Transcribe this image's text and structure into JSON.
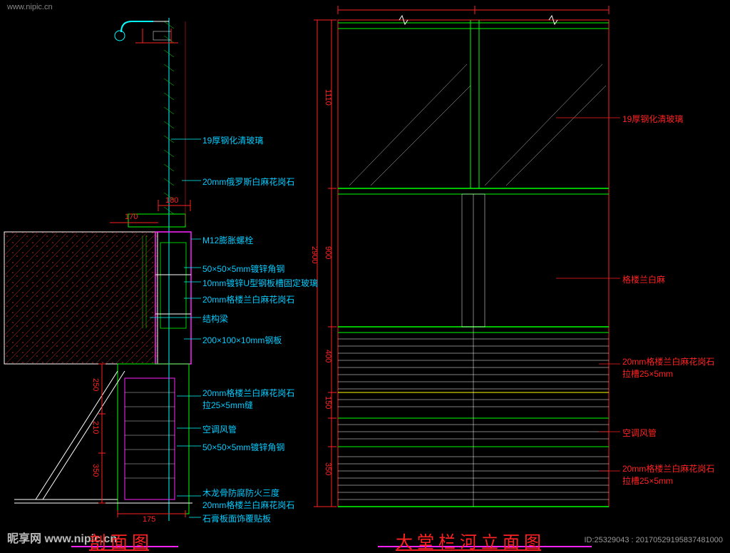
{
  "watermark": {
    "top": "www.nipic.cn",
    "bottom": "昵享网 www.nipic.cn",
    "right": "ID:25329043 : 20170529195837481000"
  },
  "titles": {
    "left": "剖 面 图",
    "right": "大 堂 栏 河 立 面 图"
  },
  "left_labels": {
    "l1": "19厚钢化清玻璃",
    "l2": "20mm俄罗斯白麻花岗石",
    "l3": "M12膨胀螺栓",
    "l4": "50×50×5mm镀锌角钢",
    "l5": "10mm镀锌U型钢板槽固定玻璃",
    "l6": "20mm格楼兰白麻花岗石",
    "l7": "结构梁",
    "l8": "200×100×10mm钢板",
    "l9": "20mm格楼兰白麻花岗石\n拉25×5mm缝",
    "l10": "空调风管",
    "l11": "50×50×5mm镀锌角钢",
    "l12": "木龙骨防腐防火三度\n20mm格楼兰白麻花岗石",
    "l13": "石膏板面饰覆贴板"
  },
  "left_dims": {
    "d1": "180",
    "d2": "170",
    "d3": "175",
    "d4": "250",
    "d5": "210",
    "d6": "350"
  },
  "right_labels": {
    "r1": "19厚钢化清玻璃",
    "r2": "格楼兰白麻",
    "r3": "20mm格楼兰白麻花岗石\n拉槽25×5mm",
    "r4": "空调风管",
    "r5": "20mm格楼兰白麻花岗石\n拉槽25×5mm"
  },
  "right_dims": {
    "v_total": "2900",
    "v1": "1110",
    "v2": "900",
    "v3": "400",
    "v4": "150",
    "v5": "350"
  },
  "chart_data": {
    "type": "diagram",
    "title_left": "剖面图",
    "title_right": "大堂栏河立面图",
    "left_section_annotations_top_to_bottom": [
      "19厚钢化清玻璃",
      "20mm俄罗斯白麻花岗石",
      "M12膨胀螺栓",
      "50×50×5mm镀锌角钢",
      "10mm镀锌U型钢板槽固定玻璃",
      "20mm格楼兰白麻花岗石",
      "结构梁",
      "200×100×10mm钢板",
      "20mm格楼兰白麻花岗石 拉25×5mm缝",
      "空调风管",
      "50×50×5mm镀锌角钢",
      "木龙骨防腐防火三度 / 20mm格楼兰白麻花岗石",
      "石膏板面饰覆贴板"
    ],
    "left_section_dimensions_mm": [
      180,
      170,
      175,
      250,
      210,
      350
    ],
    "right_elevation_annotations_top_to_bottom": [
      "19厚钢化清玻璃",
      "格楼兰白麻",
      "20mm格楼兰白麻花岗石 拉槽25×5mm",
      "空调风管",
      "20mm格楼兰白麻花岗石 拉槽25×5mm"
    ],
    "right_elevation_vertical_dimensions_mm": {
      "total": 2900,
      "segments_top_to_bottom": [
        1110,
        900,
        400,
        150,
        350
      ]
    }
  }
}
